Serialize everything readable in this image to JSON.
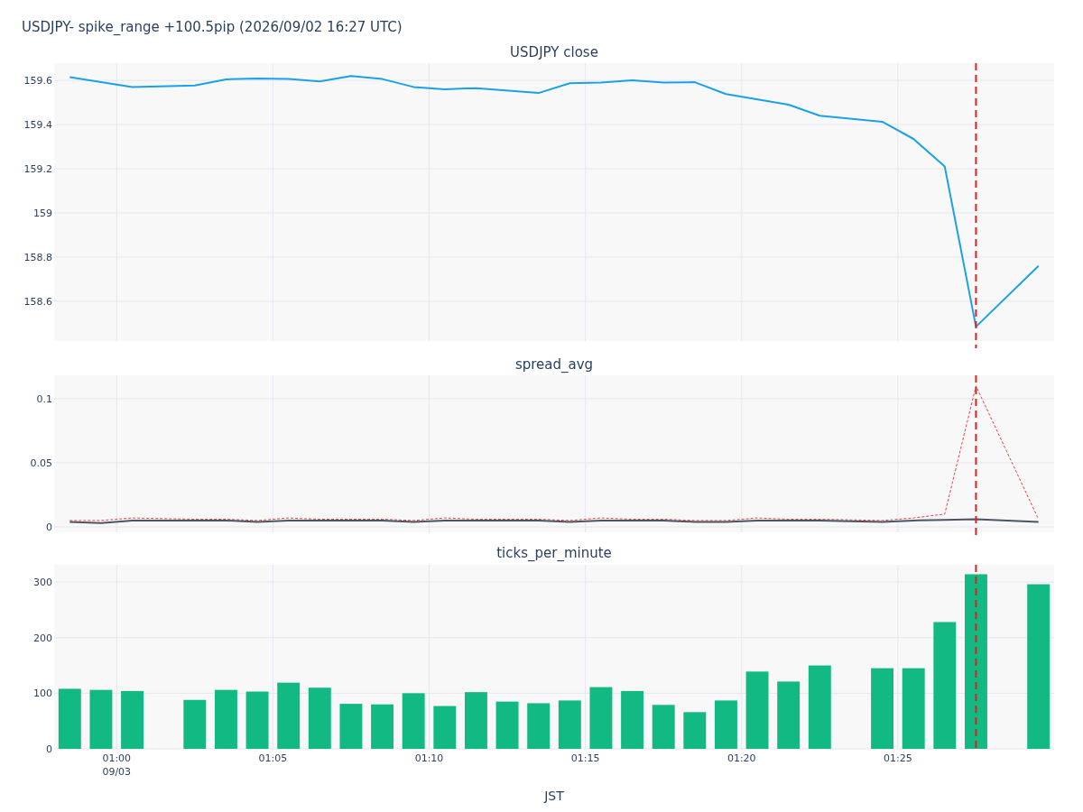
{
  "title": "USDJPY- spike_range +100.5pip (2026/09/02 16:27 UTC)",
  "charts": [
    {
      "chart_data": {
        "type": "line",
        "title": "USDJPY close",
        "categories": [
          null,
          null,
          null,
          null,
          null,
          null,
          null,
          null,
          null,
          null,
          null,
          null,
          null,
          null,
          null,
          null,
          null,
          null,
          null,
          null,
          null,
          null,
          null,
          null,
          null,
          null,
          null,
          null,
          null,
          null,
          null,
          null
        ],
        "grid": true,
        "series": [
          {
            "color": "#1ba1e6",
            "line_style": "solid",
            "values": [
              159.615,
              null,
              159.57,
              null,
              159.577,
              159.605,
              159.608,
              159.607,
              159.595,
              159.62,
              159.606,
              159.57,
              159.56,
              159.565,
              null,
              159.543,
              159.587,
              159.59,
              159.6,
              159.59,
              159.592,
              159.538,
              null,
              159.49,
              159.44,
              null,
              159.413,
              159.335,
              159.21,
              158.485,
              null,
              158.76
            ]
          }
        ],
        "ylim": [
          158.42,
          159.678
        ],
        "yticks": [
          {
            "value": 158.6,
            "label": "158.6"
          },
          {
            "value": 158.8,
            "label": "158.8"
          },
          {
            "value": 159,
            "label": "159"
          },
          {
            "value": 159.2,
            "label": "159.2"
          },
          {
            "value": 159.4,
            "label": "159.4"
          },
          {
            "value": 159.6,
            "label": "159.6"
          }
        ]
      }
    },
    {
      "chart_data": {
        "type": "line",
        "title": "spread_avg",
        "categories": [
          null,
          null,
          null,
          null,
          null,
          null,
          null,
          null,
          null,
          null,
          null,
          null,
          null,
          null,
          null,
          null,
          null,
          null,
          null,
          null,
          null,
          null,
          null,
          null,
          null,
          null,
          null,
          null,
          null,
          null,
          null,
          null
        ],
        "grid": true,
        "series": [
          {
            "color": "#ef4040",
            "line_style": "dotted",
            "values": [
              0.005,
              0.005,
              0.007,
              null,
              0.006,
              0.006,
              0.005,
              0.007,
              0.006,
              0.006,
              0.006,
              0.005,
              0.007,
              0.006,
              null,
              0.006,
              0.005,
              0.007,
              0.006,
              0.006,
              0.005,
              0.005,
              0.007,
              0.006,
              0.006,
              null,
              0.005,
              0.007,
              0.01,
              0.11,
              null,
              0.006
            ]
          },
          {
            "color": "#4a5565",
            "line_style": "solid",
            "values": [
              0.004,
              0.003,
              0.005,
              null,
              0.005,
              0.005,
              0.004,
              0.005,
              0.005,
              0.005,
              0.005,
              0.004,
              0.005,
              0.005,
              null,
              0.005,
              0.004,
              0.005,
              0.005,
              0.005,
              0.004,
              0.004,
              0.005,
              0.005,
              0.005,
              null,
              0.004,
              0.005,
              0.0055,
              0.006,
              null,
              0.004
            ]
          }
        ],
        "ylim": [
          -0.0042,
          0.1183
        ],
        "yticks": [
          {
            "value": 0,
            "label": "0"
          },
          {
            "value": 0.05,
            "label": "0.05"
          },
          {
            "value": 0.1,
            "label": "0.1"
          }
        ]
      }
    },
    {
      "chart_data": {
        "type": "bar",
        "title": "ticks_per_minute",
        "xlabel": "JST",
        "categories": [
          null,
          null,
          "01:00\n09/03",
          null,
          null,
          null,
          null,
          "01:05",
          null,
          null,
          null,
          null,
          "01:10",
          null,
          null,
          null,
          null,
          "01:15",
          null,
          null,
          null,
          null,
          "01:20",
          null,
          null,
          null,
          null,
          "01:25",
          null,
          null,
          null,
          null
        ],
        "grid": true,
        "series": [
          {
            "color": "#12b982",
            "values": [
              108,
              106,
              104,
              null,
              88,
              106,
              103,
              119,
              110,
              81,
              80,
              100,
              77,
              102,
              85,
              82,
              87,
              111,
              104,
              79,
              66,
              87,
              139,
              121,
              150,
              null,
              145,
              145,
              228,
              314,
              null,
              296
            ]
          }
        ],
        "ylim": [
          0,
          331
        ],
        "yticks": [
          {
            "value": 0,
            "label": "0"
          },
          {
            "value": 100,
            "label": "100"
          },
          {
            "value": 200,
            "label": "200"
          },
          {
            "value": 300,
            "label": "300"
          }
        ]
      }
    }
  ]
}
